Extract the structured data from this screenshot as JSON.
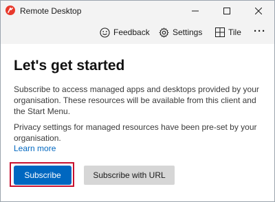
{
  "window": {
    "title": "Remote Desktop",
    "app_icon": "remote-desktop-logo"
  },
  "toolbar": {
    "feedback_label": "Feedback",
    "settings_label": "Settings",
    "tile_label": "Tile",
    "more_label": "···"
  },
  "main": {
    "heading": "Let's get started",
    "paragraph1": "Subscribe to access managed apps and desktops provided by your organisation. These resources will be available from this client and the Start Menu.",
    "paragraph2": "Privacy settings for managed resources have been pre-set by your organisation.",
    "learn_more": "Learn more",
    "subscribe_label": "Subscribe",
    "subscribe_url_label": "Subscribe with URL"
  },
  "colors": {
    "accent": "#0067c0",
    "highlight_border": "#c8102e",
    "secondary_button": "#d6d6d6"
  }
}
